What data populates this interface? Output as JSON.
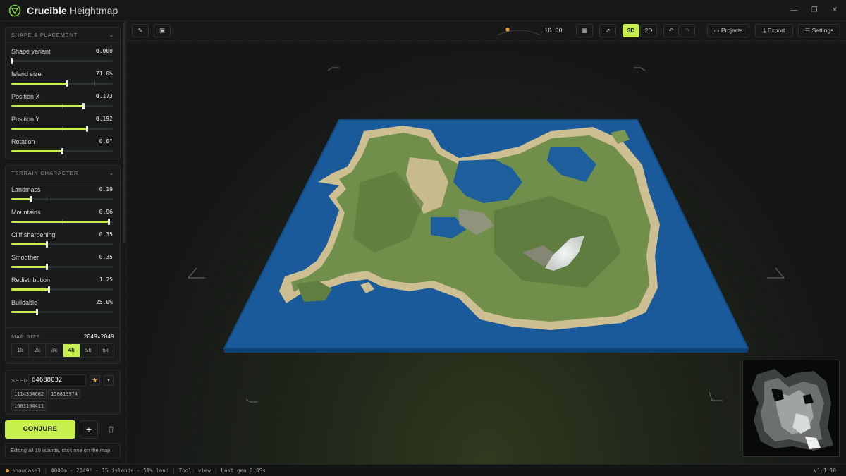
{
  "app": {
    "name": "Crucible",
    "subtitle": "Heightmap"
  },
  "sections": {
    "shape": {
      "title": "SHAPE & PLACEMENT",
      "sliders": [
        {
          "label": "Shape variant",
          "value": "0.000",
          "fraction": 0.0,
          "tick": null
        },
        {
          "label": "Island size",
          "value": "71.0%",
          "fraction": 0.55,
          "tick": 0.82
        },
        {
          "label": "Position X",
          "value": "0.173",
          "fraction": 0.71,
          "tick": 0.5
        },
        {
          "label": "Position Y",
          "value": "0.192",
          "fraction": 0.74,
          "tick": 0.5
        },
        {
          "label": "Rotation",
          "value": "0.0°",
          "fraction": 0.5,
          "tick": null
        }
      ]
    },
    "terrain": {
      "title": "TERRAIN CHARACTER",
      "sliders": [
        {
          "label": "Landmass",
          "value": "0.19",
          "fraction": 0.19,
          "tick": 0.35
        },
        {
          "label": "Mountains",
          "value": "0.96",
          "fraction": 0.96,
          "tick": 0.5
        },
        {
          "label": "Cliff sharpening",
          "value": "0.35",
          "fraction": 0.35,
          "tick": null
        },
        {
          "label": "Smoother",
          "value": "0.35",
          "fraction": 0.35,
          "tick": null
        },
        {
          "label": "Redistribution",
          "value": "1.25",
          "fraction": 0.37,
          "tick": 0.3
        },
        {
          "label": "Buildable",
          "value": "25.0%",
          "fraction": 0.25,
          "tick": null
        }
      ]
    }
  },
  "map_size": {
    "title": "MAP SIZE",
    "value": "2049×2049",
    "options": [
      "1k",
      "2k",
      "3k",
      "4k",
      "5k",
      "6k"
    ],
    "selected": "4k"
  },
  "seed": {
    "label": "SEED",
    "value": "64688032",
    "history": [
      "1114334682",
      "150819974",
      "1603104411"
    ]
  },
  "actions": {
    "conjure": "CONJURE",
    "add": "+",
    "hint": "Editing all 15 islands, click one on the map"
  },
  "toolbar": {
    "time": "10:00",
    "view_3d": "3D",
    "view_2d": "2D",
    "active_view": "3D",
    "projects": "Projects",
    "export": "Export",
    "settings": "Settings"
  },
  "status": {
    "project": "showcase3",
    "info": "4000m · 2049² · 15 islands · 51% land",
    "tool": "Tool: view",
    "last_gen": "Last gen 0.05s",
    "version": "v1.1.10"
  },
  "colors": {
    "accent": "#c7ef4e",
    "water": "#1b5c9c",
    "sand": "#c9bc8f",
    "grass": "#6f8f4a",
    "snow": "#e9ecea"
  }
}
